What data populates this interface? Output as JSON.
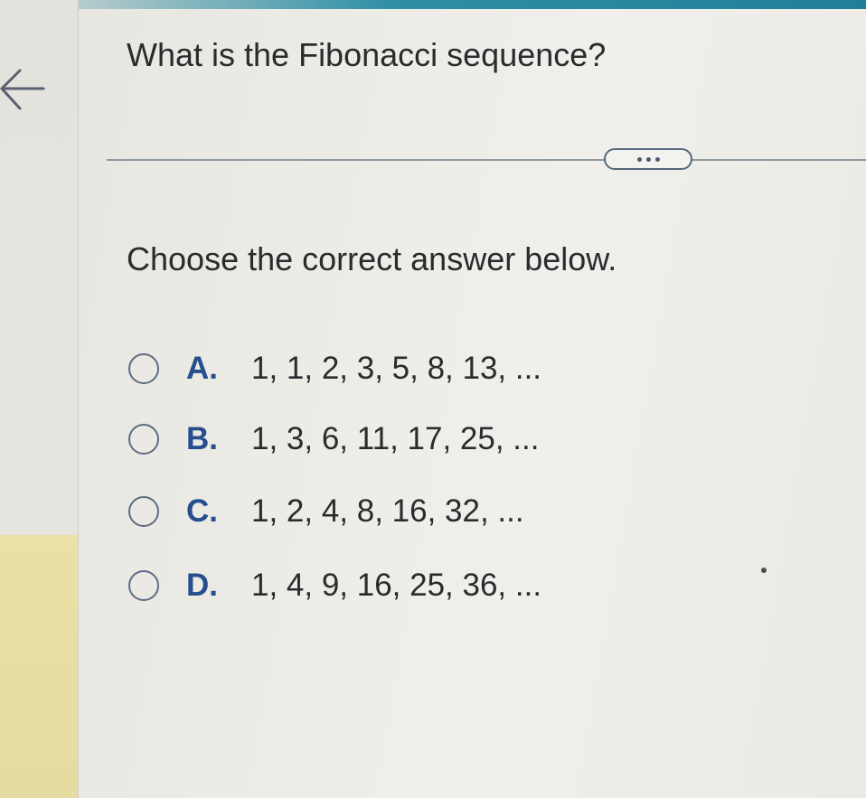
{
  "question": "What is the Fibonacci sequence?",
  "instruction": "Choose the correct answer below.",
  "options": [
    {
      "letter": "A.",
      "text": "1, 1, 2, 3, 5, 8, 13, ..."
    },
    {
      "letter": "B.",
      "text": "1, 3, 6, 11, 17, 25, ..."
    },
    {
      "letter": "C.",
      "text": "1, 2, 4, 8, 16, 32, ..."
    },
    {
      "letter": "D.",
      "text": "1, 4, 9, 16, 25, 36, ..."
    }
  ],
  "icons": {
    "back": "back-arrow-icon",
    "more": "ellipsis-icon"
  },
  "colors": {
    "accent": "#1f7f98",
    "option_letter": "#274e8c",
    "radio_border": "#5d6c84",
    "text": "#2a2b2d",
    "rail_highlight": "#e6dba0"
  }
}
